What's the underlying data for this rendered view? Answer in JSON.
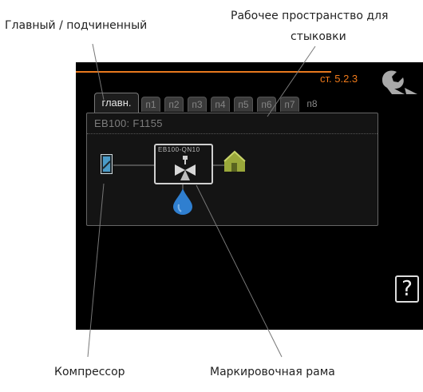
{
  "annotations": {
    "master_slave": "Главный / подчиненный",
    "docking_workspace_line1": "Рабочее пространство для",
    "docking_workspace_line2": "стыковки",
    "compressor": "Компрессор",
    "marking_frame": "Маркировочная рама"
  },
  "screen": {
    "page_number": "ст. 5.2.3",
    "tabs": [
      {
        "label": "главн.",
        "active": true
      },
      {
        "label": "п1"
      },
      {
        "label": "п2"
      },
      {
        "label": "п3"
      },
      {
        "label": "п4"
      },
      {
        "label": "п5"
      },
      {
        "label": "п6"
      },
      {
        "label": "п7"
      },
      {
        "label": "п8"
      }
    ],
    "panel_title": "EB100: F1155",
    "frame_label": "EB100-QN10",
    "help_label": "?"
  },
  "colors": {
    "accent_orange": "#e8781e",
    "screen_bg": "#000000",
    "drop_blue": "#2f7fd0",
    "house_green": "#9aa83a",
    "compressor_blue": "#4a9bc8"
  },
  "icons": [
    "wrench-icon",
    "compressor-icon",
    "valve-icon",
    "house-icon",
    "water-drop-icon",
    "help-icon"
  ]
}
